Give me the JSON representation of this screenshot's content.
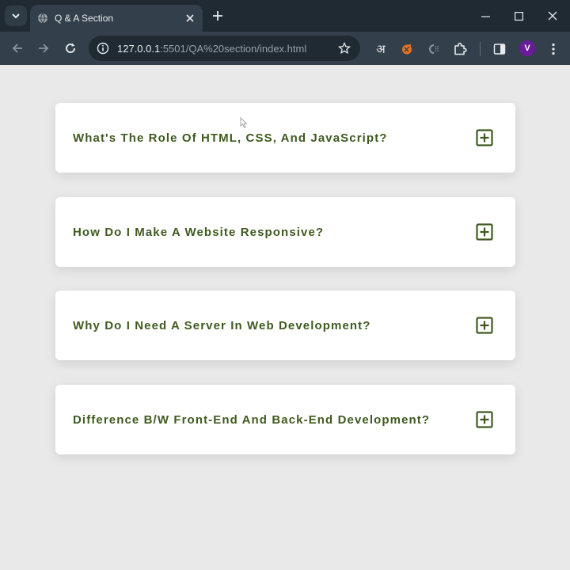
{
  "browser": {
    "tab_title": "Q & A Section",
    "url_host": "127.0.0.1",
    "url_path": ":5501/QA%20section/index.html",
    "profile_initial": "V",
    "translate_ext_glyph": "अ"
  },
  "qa": {
    "items": [
      {
        "question": "What's The Role Of HTML, CSS, And JavaScript?"
      },
      {
        "question": "How Do I Make A Website Responsive?"
      },
      {
        "question": "Why Do I Need A Server In Web Development?"
      },
      {
        "question": "Difference B/W Front-End And Back-End Development?"
      }
    ]
  },
  "colors": {
    "accent": "#3e5a1e",
    "page_bg": "#e9e9e9",
    "card_bg": "#ffffff",
    "chrome_dark": "#1f2a33",
    "chrome_toolbar": "#33404b"
  },
  "icons": {
    "expand": "plus-square-icon"
  }
}
